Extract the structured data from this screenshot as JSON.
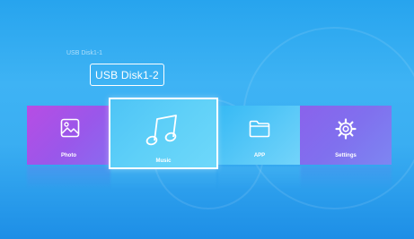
{
  "storage": {
    "header": "USB Disk1-1",
    "selected_disk": "USB Disk1-2"
  },
  "tiles": [
    {
      "label": "Photo",
      "icon": "image-icon",
      "color": "#a955e8"
    },
    {
      "label": "Music",
      "icon": "music-note-icon",
      "color": "#5fd0f8",
      "selected": true
    },
    {
      "label": "APP",
      "icon": "folder-icon",
      "color": "#4cc4f6"
    },
    {
      "label": "Settings",
      "icon": "gear-icon",
      "color": "#8470ee"
    }
  ],
  "colors": {
    "background": "#3aaef2",
    "focus_border": "#ffffff"
  }
}
